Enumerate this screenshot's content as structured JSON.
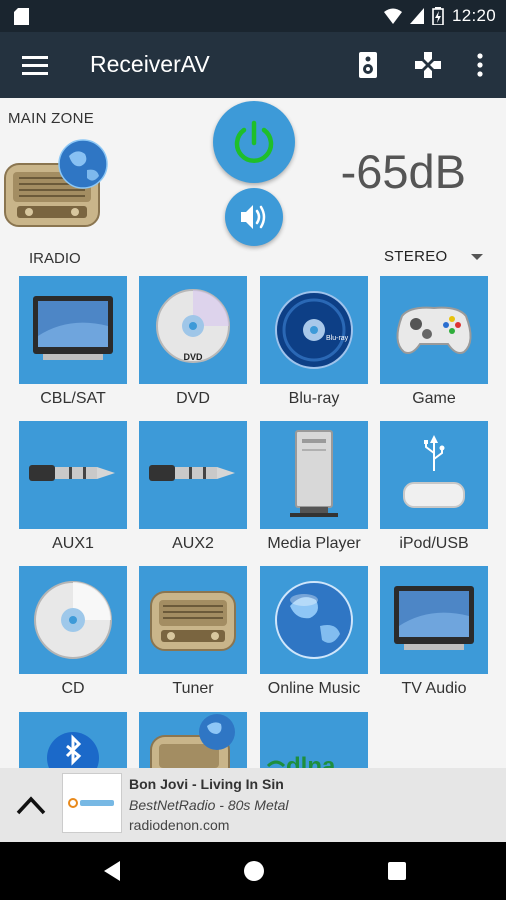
{
  "status": {
    "time": "12:20"
  },
  "appbar": {
    "title": "ReceiverAV"
  },
  "zone": {
    "label": "MAIN ZONE",
    "volume": "-65dB",
    "source": "IRADIO",
    "mode": "STEREO"
  },
  "inputs": [
    {
      "label": "CBL/SAT",
      "icon": "tv-monitor-icon"
    },
    {
      "label": "DVD",
      "icon": "dvd-disc-icon"
    },
    {
      "label": "Blu-ray",
      "icon": "bluray-disc-icon"
    },
    {
      "label": "Game",
      "icon": "gamepad-icon"
    },
    {
      "label": "AUX1",
      "icon": "audio-jack-icon"
    },
    {
      "label": "AUX2",
      "icon": "audio-jack-icon"
    },
    {
      "label": "Media Player",
      "icon": "media-player-icon"
    },
    {
      "label": "iPod/USB",
      "icon": "usb-dock-icon"
    },
    {
      "label": "CD",
      "icon": "cd-disc-icon"
    },
    {
      "label": "Tuner",
      "icon": "radio-icon"
    },
    {
      "label": "Online Music",
      "icon": "globe-icon"
    },
    {
      "label": "TV Audio",
      "icon": "tv-monitor-icon"
    },
    {
      "label": "",
      "icon": "bluetooth-icon"
    },
    {
      "label": "",
      "icon": "internet-radio-icon"
    },
    {
      "label": "",
      "icon": "dlna-icon"
    }
  ],
  "now_playing": {
    "title": "Bon Jovi - Living In Sin",
    "station": "BestNetRadio - 80s Metal",
    "source": "radiodenon.com"
  }
}
